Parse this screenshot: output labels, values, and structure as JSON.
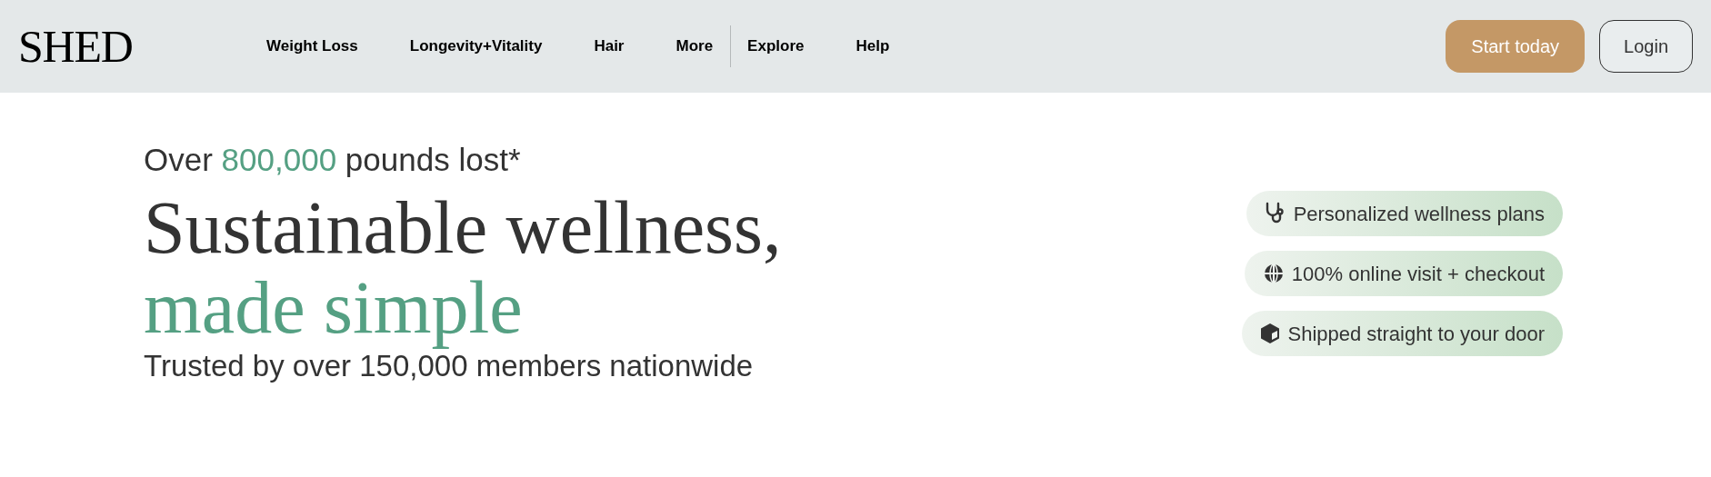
{
  "header": {
    "logo": "SHED",
    "nav": [
      {
        "label": "Weight Loss"
      },
      {
        "label": "Longevity+Vitality"
      },
      {
        "label": "Hair"
      },
      {
        "label": "More"
      }
    ],
    "nav_secondary": [
      {
        "label": "Explore"
      },
      {
        "label": "Help"
      }
    ],
    "actions": {
      "primary": "Start today",
      "secondary": "Login"
    }
  },
  "hero": {
    "stat": {
      "prefix": "Over",
      "highlight": "800,000",
      "suffix": "pounds lost*"
    },
    "headline": "Sustainable wellness,",
    "headline_accent": "made simple",
    "subtitle": "Trusted by over 150,000 members nationwide",
    "features": [
      {
        "kind": "stethoscope",
        "label": "Personalized wellness plans"
      },
      {
        "kind": "globe",
        "label": "100% online visit + checkout"
      },
      {
        "kind": "box",
        "label": "Shipped straight to your door"
      }
    ]
  }
}
